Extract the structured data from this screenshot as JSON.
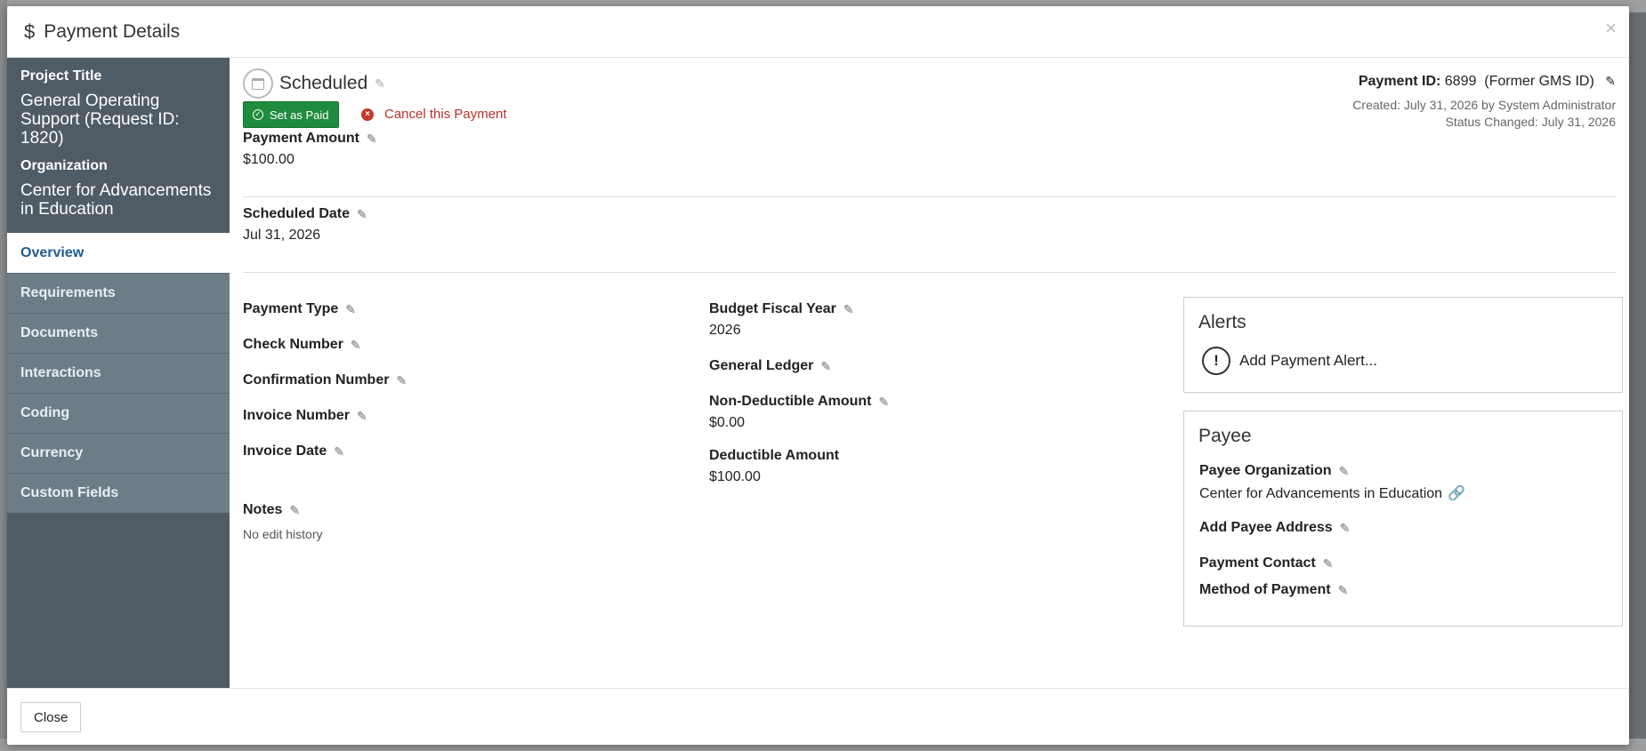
{
  "dialog": {
    "title": "Payment Details",
    "close_glyph": "×"
  },
  "sidebar": {
    "project_title_label": "Project Title",
    "project_title_value": "General Operating Support (Request ID: 1820)",
    "organization_label": "Organization",
    "organization_value": "Center for Advancements in Education",
    "items": [
      {
        "label": "Overview"
      },
      {
        "label": "Requirements"
      },
      {
        "label": "Documents"
      },
      {
        "label": "Interactions"
      },
      {
        "label": "Coding"
      },
      {
        "label": "Currency"
      },
      {
        "label": "Custom Fields"
      }
    ]
  },
  "status": {
    "label": "Scheduled",
    "set_paid_label": "Set as Paid",
    "cancel_label": "Cancel this Payment"
  },
  "payment_info": {
    "id_label": "Payment ID:",
    "id_value": "6899",
    "former_id": "(Former GMS ID)",
    "created": "Created: July 31, 2026 by System Administrator",
    "status_changed": "Status Changed: July 31, 2026"
  },
  "fields": {
    "payment_amount_label": "Payment Amount",
    "payment_amount_value": "$100.00",
    "scheduled_date_label": "Scheduled Date",
    "scheduled_date_value": "Jul 31, 2026",
    "payment_type_label": "Payment Type",
    "check_number_label": "Check Number",
    "confirmation_number_label": "Confirmation Number",
    "invoice_number_label": "Invoice Number",
    "invoice_date_label": "Invoice Date",
    "notes_label": "Notes",
    "notes_history": "No edit history",
    "budget_fiscal_year_label": "Budget Fiscal Year",
    "budget_fiscal_year_value": "2026",
    "general_ledger_label": "General Ledger",
    "non_deductible_label": "Non-Deductible Amount",
    "non_deductible_value": "$0.00",
    "deductible_label": "Deductible Amount",
    "deductible_value": "$100.00"
  },
  "alerts": {
    "title": "Alerts",
    "add_label": "Add Payment Alert..."
  },
  "payee": {
    "title": "Payee",
    "organization_label": "Payee Organization",
    "organization_value": "Center for Advancements in Education",
    "address_label": "Add Payee Address",
    "contact_label": "Payment Contact",
    "method_label": "Method of Payment"
  },
  "footer": {
    "close_label": "Close"
  },
  "colors": {
    "sidebar_bg": "#4f5c66",
    "nav_bg": "#6c7d88",
    "active_nav_text": "#1e5b8f",
    "success": "#1e8b3d",
    "danger": "#c0392b"
  },
  "icons": {
    "dollar": "$",
    "pencil": "✎",
    "link": "🔗",
    "check": "✓",
    "x": "×",
    "exclamation": "!"
  }
}
